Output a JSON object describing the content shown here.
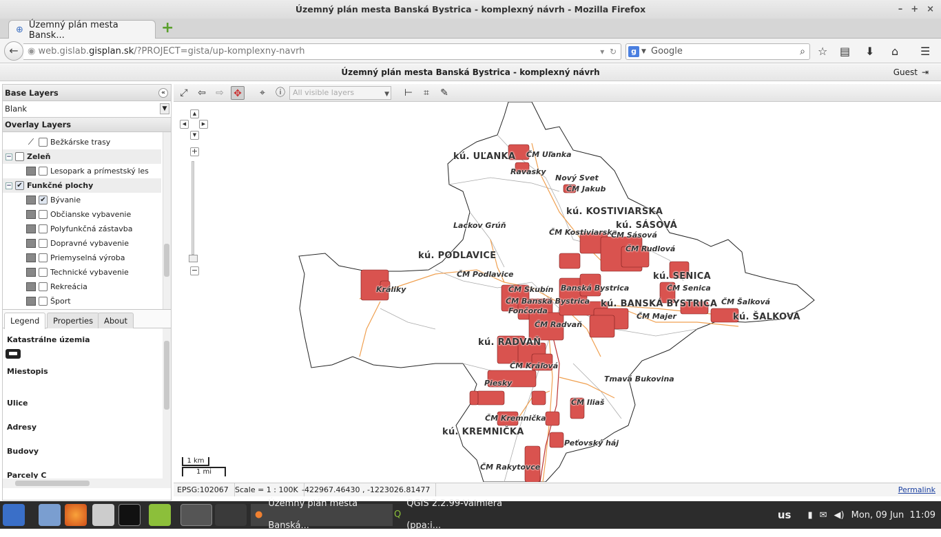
{
  "window": {
    "title": "Územný plán mesta Banská Bystrica - komplexný návrh - Mozilla Firefox",
    "controls": [
      "–",
      "+",
      "×"
    ]
  },
  "tab": {
    "title": "Územný plán mesta Bansk...",
    "new_tab": "+"
  },
  "nav": {
    "url_pre": "web.gislab.",
    "url_domain": "gisplan.sk",
    "url_post": "/?PROJECT=gista/up-komplexny-navrh",
    "search_placeholder": "Google",
    "search_engine": "g"
  },
  "app": {
    "title": "Územný plán mesta Banská Bystrica - komplexný návrh",
    "user": "Guest"
  },
  "left": {
    "base_layers_title": "Base Layers",
    "base_selected": "Blank",
    "overlay_title": "Overlay Layers",
    "tree": [
      {
        "label": "Bežkárske trasy",
        "type": "layer",
        "icon": "line",
        "checked": false
      },
      {
        "label": "Zeleň",
        "type": "group",
        "checked": false
      },
      {
        "label": "Lesopark a prímestský les",
        "type": "layer",
        "checked": false
      },
      {
        "label": "Funkčné plochy",
        "type": "group",
        "checked": true
      },
      {
        "label": "Bývanie",
        "type": "layer",
        "checked": true
      },
      {
        "label": "Občianske vybavenie",
        "type": "layer",
        "checked": false
      },
      {
        "label": "Polyfunkčná zástavba",
        "type": "layer",
        "checked": false
      },
      {
        "label": "Dopravné vybavenie",
        "type": "layer",
        "checked": false
      },
      {
        "label": "Priemyselná výroba",
        "type": "layer",
        "checked": false
      },
      {
        "label": "Technické vybavenie",
        "type": "layer",
        "checked": false
      },
      {
        "label": "Rekreácia",
        "type": "layer",
        "checked": false
      },
      {
        "label": "Šport",
        "type": "layer",
        "checked": false
      }
    ],
    "tabs": [
      "Legend",
      "Properties",
      "About"
    ],
    "legend": [
      "Katastrálne územia",
      "Miestopis",
      "Ulice",
      "Adresy",
      "Budovy",
      "Parcely C"
    ]
  },
  "toolbar": {
    "layer_select": "All visible layers"
  },
  "map": {
    "labels_big": [
      "kú. UĽANKA",
      "kú. KOSTIVIARSKA",
      "kú. SÁSOVÁ",
      "kú. PODLAVICE",
      "kú. SENICA",
      "kú. BANSKÁ BYSTRICA",
      "kú. ŠALKOVÁ",
      "kú. RADVAŇ",
      "kú. KREMNIČKA"
    ],
    "labels_small": [
      "ČM Uľanka",
      "Ravasky",
      "Nový Svet",
      "ČM Jakub",
      "ČM Kostiviarska",
      "ČM Sásová",
      "ČM Rudlová",
      "Lackov Grúň",
      "ČM Podlavice",
      "Králiky",
      "ČM Skubín",
      "Banská Bystrica",
      "ČM Senica",
      "ČM Banská Bystrica",
      "ČM Šalková",
      "Fončorda",
      "ČM Majer",
      "ČM Radvaň",
      "ČM Kráľová",
      "Tmavá Bukovina",
      "Piesky",
      "ČM Iliaš",
      "ČM Kremnička",
      "Peťovský háj",
      "ČM Rakytovce"
    ],
    "scale_km": "1 km",
    "scale_mi": "1 mi",
    "colors": {
      "urban": "#d9534f",
      "boundary": "#222222",
      "road": "#f0a050"
    }
  },
  "status": {
    "epsg": "EPSG:102067",
    "scale": "Scale = 1 : 100K",
    "coords": "-422967.46430 , -1223026.81477",
    "permalink": "Permalink"
  },
  "taskbar": {
    "win1": "Územný plán mesta Banská...",
    "win2": "QGIS 2.2.99-Valmiera (ppa:i...",
    "kbd": "us",
    "clock": "Mon, 09 Jun  11:09"
  }
}
